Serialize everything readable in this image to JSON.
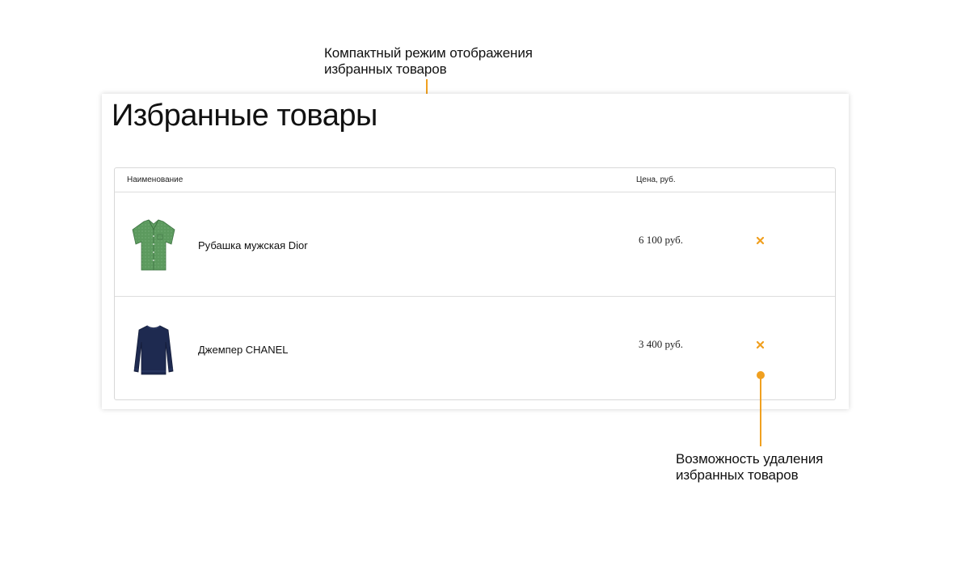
{
  "annotations": {
    "top": {
      "line1": "Компактный режим отображения",
      "line2": "избранных товаров"
    },
    "bottom": {
      "line1": "Возможность удаления",
      "line2": "избранных товаров"
    },
    "accent_color": "#f0a020"
  },
  "page": {
    "title": "Избранные товары"
  },
  "table": {
    "headers": {
      "name": "Наименование",
      "price": "Цена, руб."
    },
    "rows": [
      {
        "name": "Рубашка мужская Dior",
        "price": "6 100 руб.",
        "image_icon": "green-shirt-image",
        "image_color": "#5c9a5e",
        "remove_icon": "close-icon"
      },
      {
        "name": "Джемпер CHANEL",
        "price": "3 400 руб.",
        "image_icon": "navy-jumper-image",
        "image_color": "#1e2a50",
        "remove_icon": "close-icon"
      }
    ]
  },
  "remove_color": "#f0a020"
}
